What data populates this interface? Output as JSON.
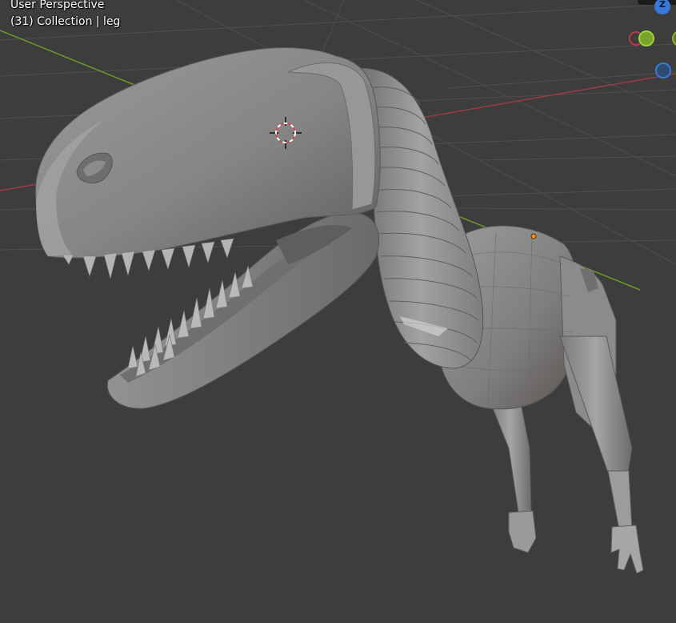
{
  "viewport": {
    "view_label": "User Perspective",
    "collection_label": "(31) Collection | leg"
  },
  "gizmo": {
    "z_label": "Z",
    "colors": {
      "x": "#b8384c",
      "y": "#76a627",
      "z": "#3778d8"
    }
  },
  "scene": {
    "background_color": "#3d3d3d",
    "grid_color": "#4e4e4e",
    "x_axis_color": "#9a3b46",
    "y_axis_color": "#6c9a2a",
    "mesh_color": "#8a8a8a",
    "cursor_icon": "3d-cursor-icon",
    "origin_icon": "object-origin-icon"
  }
}
